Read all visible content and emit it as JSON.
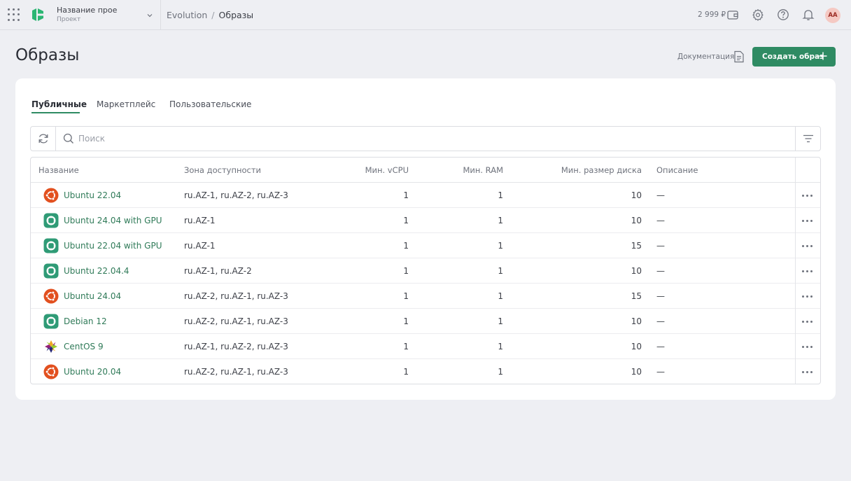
{
  "topbar": {
    "project_name": "Название прое",
    "project_type": "Проект",
    "breadcrumb_root": "Evolution",
    "breadcrumb_sep": "/",
    "breadcrumb_current": "Образы",
    "balance": "2 999 ₽",
    "avatar_initials": "АА"
  },
  "page": {
    "title": "Образы",
    "docs_label": "Документация",
    "create_label": "Создать образ"
  },
  "tabs": [
    {
      "label": "Публичные",
      "active": true
    },
    {
      "label": "Маркетплейс",
      "active": false
    },
    {
      "label": "Пользовательские",
      "active": false
    }
  ],
  "search": {
    "placeholder": "Поиск",
    "value": ""
  },
  "table": {
    "columns": {
      "name": "Название",
      "zone": "Зона доступности",
      "vcpu": "Мин. vCPU",
      "ram": "Мин. RAM",
      "disk": "Мин. размер диска",
      "desc": "Описание"
    },
    "rows": [
      {
        "icon": "ubuntu-icon",
        "name": "Ubuntu 22.04",
        "zone": "ru.AZ-1, ru.AZ-2, ru.AZ-3",
        "vcpu": "1",
        "ram": "1",
        "disk": "10",
        "desc": "—"
      },
      {
        "icon": "generic-os-icon",
        "name": "Ubuntu 24.04 with GPU",
        "zone": "ru.AZ-1",
        "vcpu": "1",
        "ram": "1",
        "disk": "10",
        "desc": "—"
      },
      {
        "icon": "generic-os-icon",
        "name": "Ubuntu 22.04 with GPU",
        "zone": "ru.AZ-1",
        "vcpu": "1",
        "ram": "1",
        "disk": "15",
        "desc": "—"
      },
      {
        "icon": "generic-os-icon",
        "name": "Ubuntu 22.04.4",
        "zone": "ru.AZ-1, ru.AZ-2",
        "vcpu": "1",
        "ram": "1",
        "disk": "10",
        "desc": "—"
      },
      {
        "icon": "ubuntu-icon",
        "name": "Ubuntu 24.04",
        "zone": "ru.AZ-2, ru.AZ-1, ru.AZ-3",
        "vcpu": "1",
        "ram": "1",
        "disk": "15",
        "desc": "—"
      },
      {
        "icon": "generic-os-icon",
        "name": "Debian 12",
        "zone": "ru.AZ-2, ru.AZ-1, ru.AZ-3",
        "vcpu": "1",
        "ram": "1",
        "disk": "10",
        "desc": "—"
      },
      {
        "icon": "centos-icon",
        "name": "CentOS 9",
        "zone": "ru.AZ-1, ru.AZ-2, ru.AZ-3",
        "vcpu": "1",
        "ram": "1",
        "disk": "10",
        "desc": "—"
      },
      {
        "icon": "ubuntu-icon",
        "name": "Ubuntu 20.04",
        "zone": "ru.AZ-2, ru.AZ-1, ru.AZ-3",
        "vcpu": "1",
        "ram": "1",
        "disk": "10",
        "desc": "—"
      }
    ]
  },
  "colors": {
    "accent": "#2f8b63",
    "link": "#2f7a58",
    "ubuntu": "#e2501f",
    "generic": "#2f9b76"
  }
}
